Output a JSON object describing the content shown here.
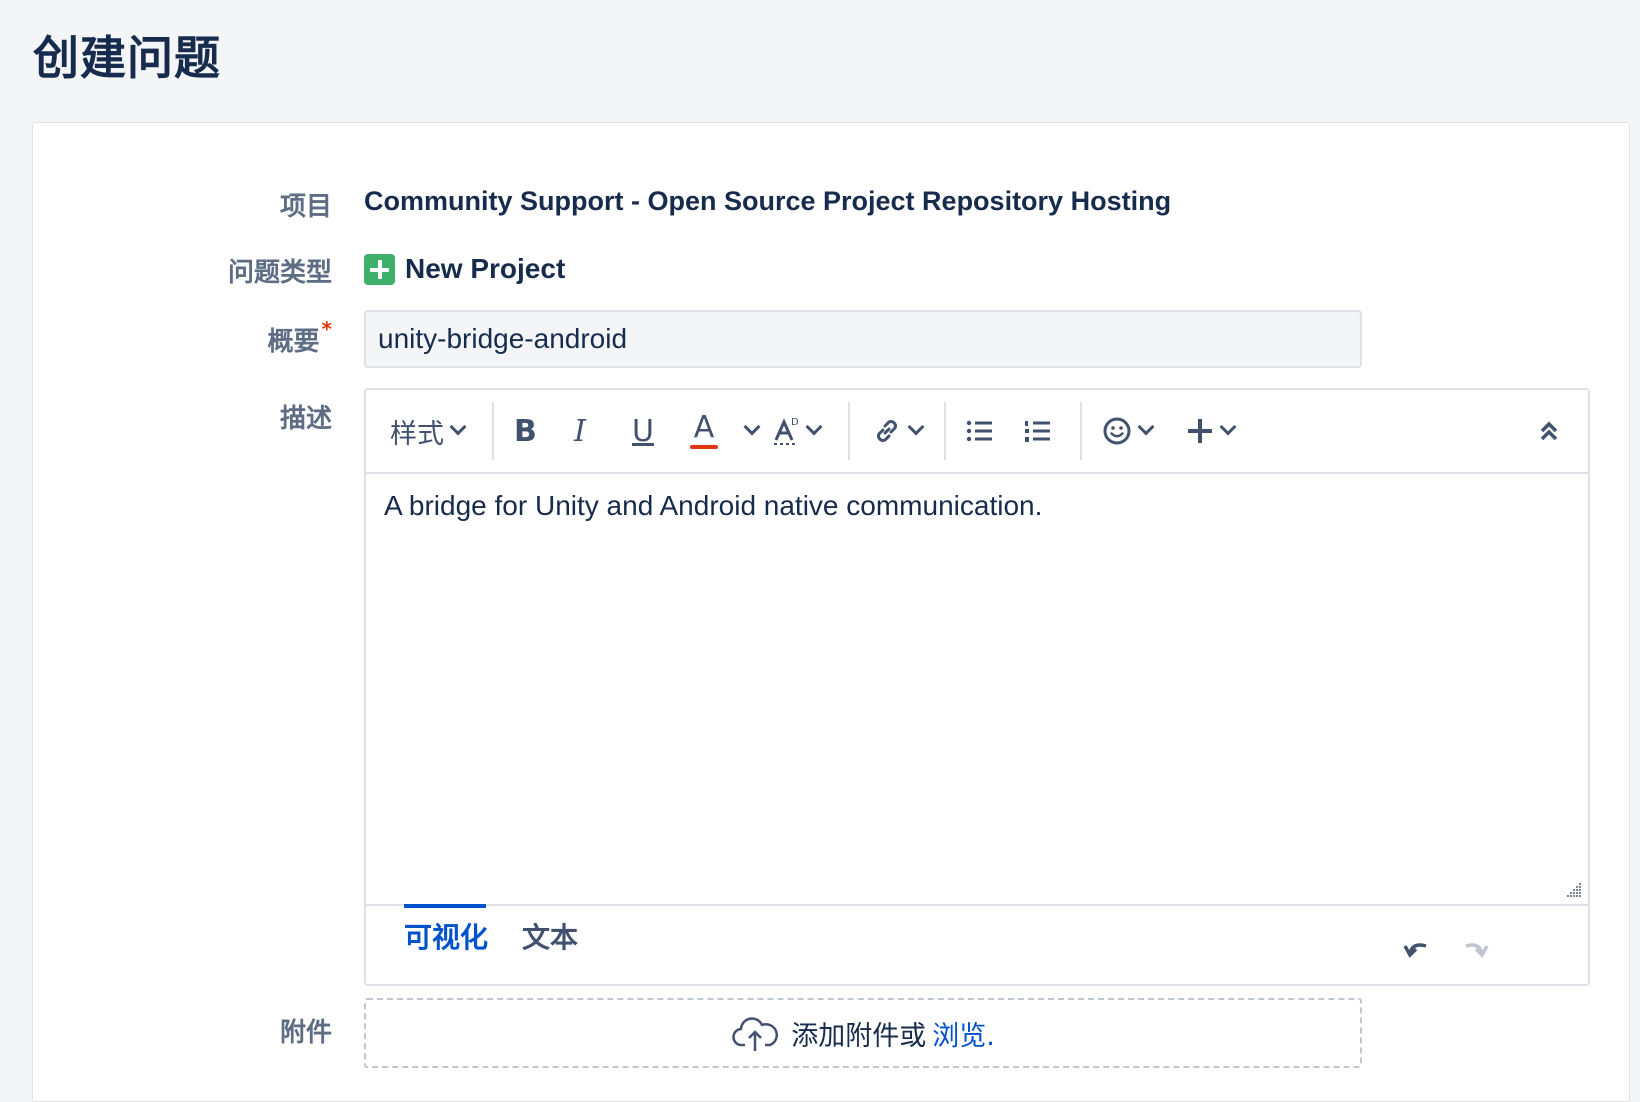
{
  "page": {
    "title": "创建问题"
  },
  "form": {
    "project": {
      "label": "项目",
      "value": "Community Support - Open Source Project Repository Hosting"
    },
    "issue_type": {
      "label": "问题类型",
      "value": "New Project",
      "icon": "plus-square-icon",
      "icon_color": "#3eb06b"
    },
    "summary": {
      "label": "概要",
      "required_mark": "*",
      "value": "unity-bridge-android"
    },
    "description": {
      "label": "描述",
      "toolbar": {
        "style_label": "样式",
        "bold": "B",
        "italic": "I",
        "underline": "U",
        "text_color": "A",
        "text_color_underline": "#de350b"
      },
      "body": "A bridge for Unity and Android native communication.",
      "tabs": [
        "可视化",
        "文本"
      ],
      "active_tab": "可视化"
    },
    "attachment": {
      "label": "附件",
      "text": "添加附件或",
      "link": "浏览."
    }
  },
  "colors": {
    "accent": "#0052cc",
    "required": "#de350b",
    "text": "#172b4d",
    "label": "#5e6c84"
  }
}
